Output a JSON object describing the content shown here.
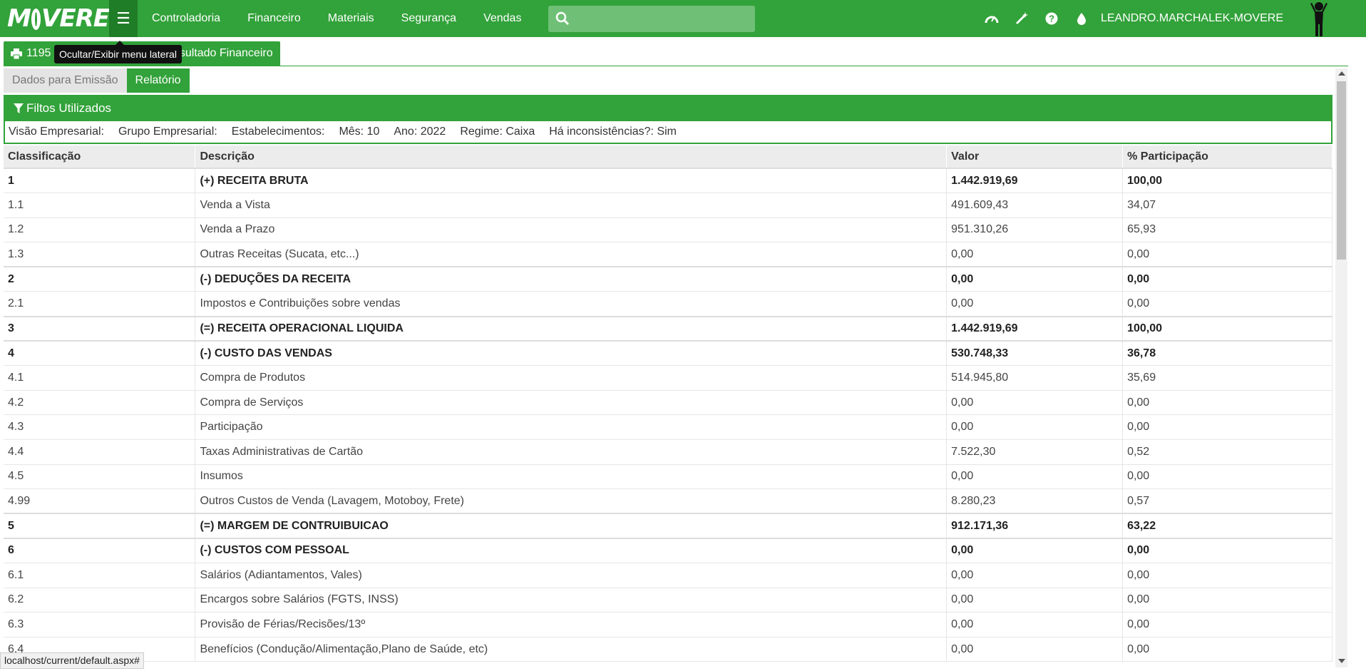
{
  "app": {
    "logo_text_m": "M",
    "logo_text_rest": "VERE",
    "brand_color": "#32a23a"
  },
  "navbar": {
    "items": [
      "Controladoria",
      "Financeiro",
      "Materiais",
      "Segurança",
      "Vendas"
    ],
    "search_placeholder": "",
    "user": "LEANDRO.MARCHALEK-MOVERE"
  },
  "tooltip": "Ocultar/Exibir menu lateral",
  "window": {
    "code": "1195",
    "title": "Resultado Financeiro"
  },
  "subtabs": [
    "Dados para Emissão",
    "Relatório"
  ],
  "filters": {
    "header": "Filtos Utilizados",
    "items": [
      "Visão Empresarial:",
      "Grupo Empresarial:",
      "Estabelecimentos:",
      "Mês: 10",
      "Ano: 2022",
      "Regime: Caixa",
      "Há inconsistências?: Sim"
    ]
  },
  "table": {
    "headers": [
      "Classificação",
      "Descrição",
      "Valor",
      "% Participação"
    ],
    "rows": [
      {
        "c": "1",
        "d": "(+) RECEITA BRUTA",
        "v": "1.442.919,69",
        "p": "100,00",
        "g": true
      },
      {
        "c": "1.1",
        "d": "Venda a Vista",
        "v": "491.609,43",
        "p": "34,07",
        "g": false
      },
      {
        "c": "1.2",
        "d": "Venda a Prazo",
        "v": "951.310,26",
        "p": "65,93",
        "g": false
      },
      {
        "c": "1.3",
        "d": "Outras Receitas (Sucata, etc...)",
        "v": "0,00",
        "p": "0,00",
        "g": false
      },
      {
        "c": "2",
        "d": "(-) DEDUÇÕES DA RECEITA",
        "v": "0,00",
        "p": "0,00",
        "g": true
      },
      {
        "c": "2.1",
        "d": "Impostos e Contribuições sobre vendas",
        "v": "0,00",
        "p": "0,00",
        "g": false
      },
      {
        "c": "3",
        "d": "(=) RECEITA OPERACIONAL LIQUIDA",
        "v": "1.442.919,69",
        "p": "100,00",
        "g": true
      },
      {
        "c": "4",
        "d": "(-) CUSTO DAS VENDAS",
        "v": "530.748,33",
        "p": "36,78",
        "g": true
      },
      {
        "c": "4.1",
        "d": "Compra de Produtos",
        "v": "514.945,80",
        "p": "35,69",
        "g": false
      },
      {
        "c": "4.2",
        "d": "Compra de Serviços",
        "v": "0,00",
        "p": "0,00",
        "g": false
      },
      {
        "c": "4.3",
        "d": "Participação",
        "v": "0,00",
        "p": "0,00",
        "g": false
      },
      {
        "c": "4.4",
        "d": "Taxas Administrativas de Cartão",
        "v": "7.522,30",
        "p": "0,52",
        "g": false
      },
      {
        "c": "4.5",
        "d": "Insumos",
        "v": "0,00",
        "p": "0,00",
        "g": false
      },
      {
        "c": "4.99",
        "d": "Outros Custos de Venda (Lavagem, Motoboy, Frete)",
        "v": "8.280,23",
        "p": "0,57",
        "g": false
      },
      {
        "c": "5",
        "d": "(=) MARGEM DE CONTRUIBUICAO",
        "v": "912.171,36",
        "p": "63,22",
        "g": true
      },
      {
        "c": "6",
        "d": "(-) CUSTOS COM PESSOAL",
        "v": "0,00",
        "p": "0,00",
        "g": true
      },
      {
        "c": "6.1",
        "d": "Salários (Adiantamentos, Vales)",
        "v": "0,00",
        "p": "0,00",
        "g": false
      },
      {
        "c": "6.2",
        "d": "Encargos sobre Salários (FGTS, INSS)",
        "v": "0,00",
        "p": "0,00",
        "g": false
      },
      {
        "c": "6.3",
        "d": "Provisão de Férias/Recisões/13º",
        "v": "0,00",
        "p": "0,00",
        "g": false
      },
      {
        "c": "6.4",
        "d": "Benefícios (Condução/Alimentação,Plano de Saúde, etc)",
        "v": "0,00",
        "p": "0,00",
        "g": false
      }
    ]
  },
  "statusbar": "localhost/current/default.aspx#"
}
